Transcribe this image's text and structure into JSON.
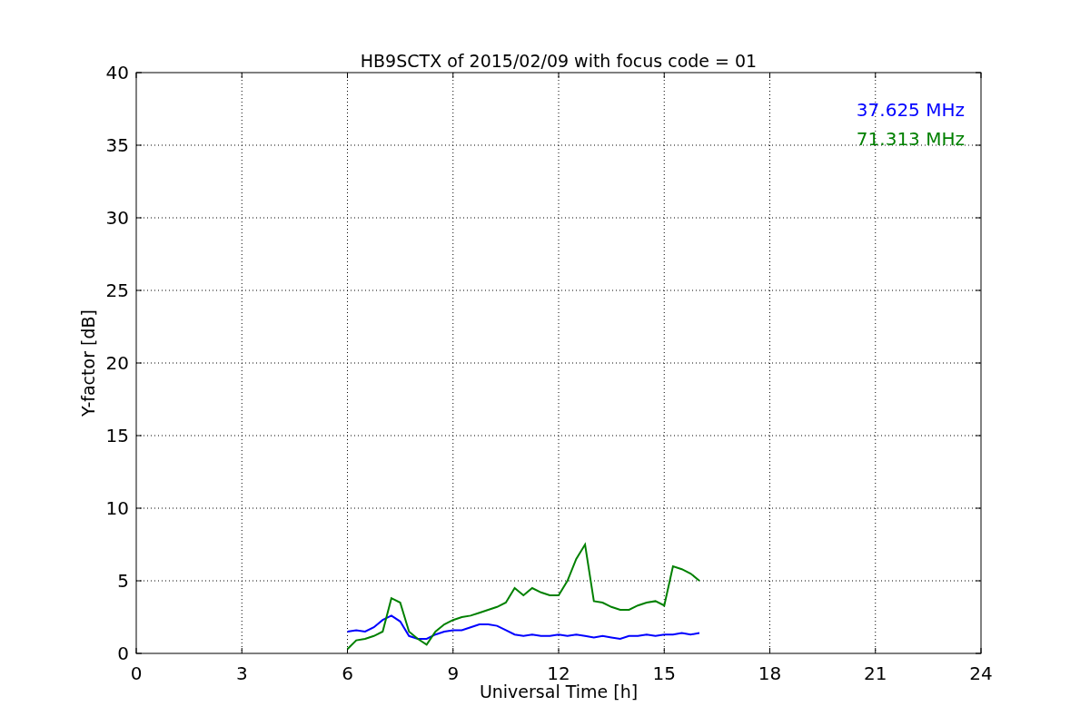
{
  "chart_data": {
    "type": "line",
    "title": "HB9SCTX of 2015/02/09 with focus code = 01",
    "xlabel": "Universal Time [h]",
    "ylabel": "Y-factor [dB]",
    "x": [
      6,
      6.25,
      6.5,
      6.75,
      7,
      7.25,
      7.5,
      7.75,
      8,
      8.25,
      8.5,
      8.75,
      9,
      9.25,
      9.5,
      9.75,
      10,
      10.25,
      10.5,
      10.75,
      11,
      11.25,
      11.5,
      11.75,
      12,
      12.25,
      12.5,
      12.75,
      13,
      13.25,
      13.5,
      13.75,
      14,
      14.25,
      14.5,
      14.75,
      15,
      15.25,
      15.5,
      15.75,
      16
    ],
    "series": [
      {
        "name": "37.625 MHz",
        "color": "#0000ff",
        "values": [
          1.5,
          1.6,
          1.5,
          1.8,
          2.3,
          2.6,
          2.2,
          1.2,
          1.0,
          1.0,
          1.3,
          1.5,
          1.6,
          1.6,
          1.8,
          2.0,
          2.0,
          1.9,
          1.6,
          1.3,
          1.2,
          1.3,
          1.2,
          1.2,
          1.3,
          1.2,
          1.3,
          1.2,
          1.1,
          1.2,
          1.1,
          1.0,
          1.2,
          1.2,
          1.3,
          1.2,
          1.3,
          1.3,
          1.4,
          1.3,
          1.4
        ]
      },
      {
        "name": "71.313 MHz",
        "color": "#008000",
        "values": [
          0.3,
          0.9,
          1.0,
          1.2,
          1.5,
          3.8,
          3.5,
          1.5,
          1.0,
          0.6,
          1.5,
          2.0,
          2.3,
          2.5,
          2.6,
          2.8,
          3.0,
          3.2,
          3.5,
          4.5,
          4.0,
          4.5,
          4.2,
          4.0,
          4.0,
          5.0,
          6.5,
          7.5,
          3.6,
          3.5,
          3.2,
          3.0,
          3.0,
          3.3,
          3.5,
          3.6,
          3.3,
          6.0,
          5.8,
          5.5,
          5.0
        ]
      }
    ],
    "grid": true,
    "xlim": [
      0,
      24
    ],
    "ylim": [
      0,
      40
    ],
    "xticks": [
      0,
      3,
      6,
      9,
      12,
      15,
      18,
      21,
      24
    ],
    "yticks": [
      0,
      5,
      10,
      15,
      20,
      25,
      30,
      35,
      40
    ]
  }
}
